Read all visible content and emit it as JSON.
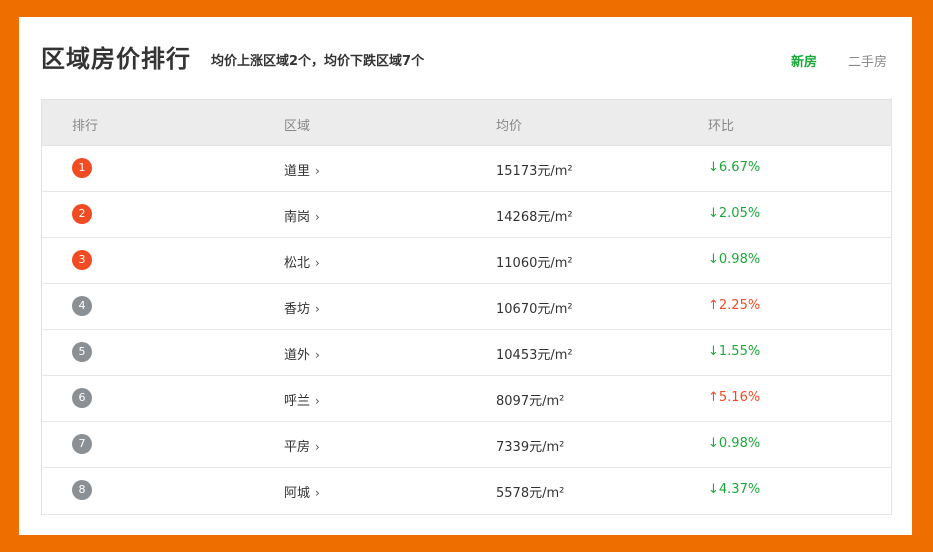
{
  "header": {
    "title": "区域房价排行",
    "summary": "均价上涨区域2个，均价下跌区域7个",
    "tabs": [
      {
        "label": "新房",
        "active": true
      },
      {
        "label": "二手房",
        "active": false
      }
    ]
  },
  "table": {
    "columns": [
      "排行",
      "区域",
      "均价",
      "环比"
    ],
    "rows": [
      {
        "rank": "1",
        "area": "道里",
        "price": "15173元/m²",
        "change": "↓6.67%",
        "direction": "down"
      },
      {
        "rank": "2",
        "area": "南岗",
        "price": "14268元/m²",
        "change": "↓2.05%",
        "direction": "down"
      },
      {
        "rank": "3",
        "area": "松北",
        "price": "11060元/m²",
        "change": "↓0.98%",
        "direction": "down"
      },
      {
        "rank": "4",
        "area": "香坊",
        "price": "10670元/m²",
        "change": "↑2.25%",
        "direction": "up"
      },
      {
        "rank": "5",
        "area": "道外",
        "price": "10453元/m²",
        "change": "↓1.55%",
        "direction": "down"
      },
      {
        "rank": "6",
        "area": "呼兰",
        "price": "8097元/m²",
        "change": "↑5.16%",
        "direction": "up"
      },
      {
        "rank": "7",
        "area": "平房",
        "price": "7339元/m²",
        "change": "↓0.98%",
        "direction": "down"
      },
      {
        "rank": "8",
        "area": "阿城",
        "price": "5578元/m²",
        "change": "↓4.37%",
        "direction": "down"
      }
    ]
  },
  "colors": {
    "frame": "#ee6e00",
    "active_tab": "#1ba83b",
    "up": "#f04b23",
    "down": "#1ba83b",
    "top_rank_badge": "#f04b23",
    "rank_badge": "#8a9094"
  }
}
